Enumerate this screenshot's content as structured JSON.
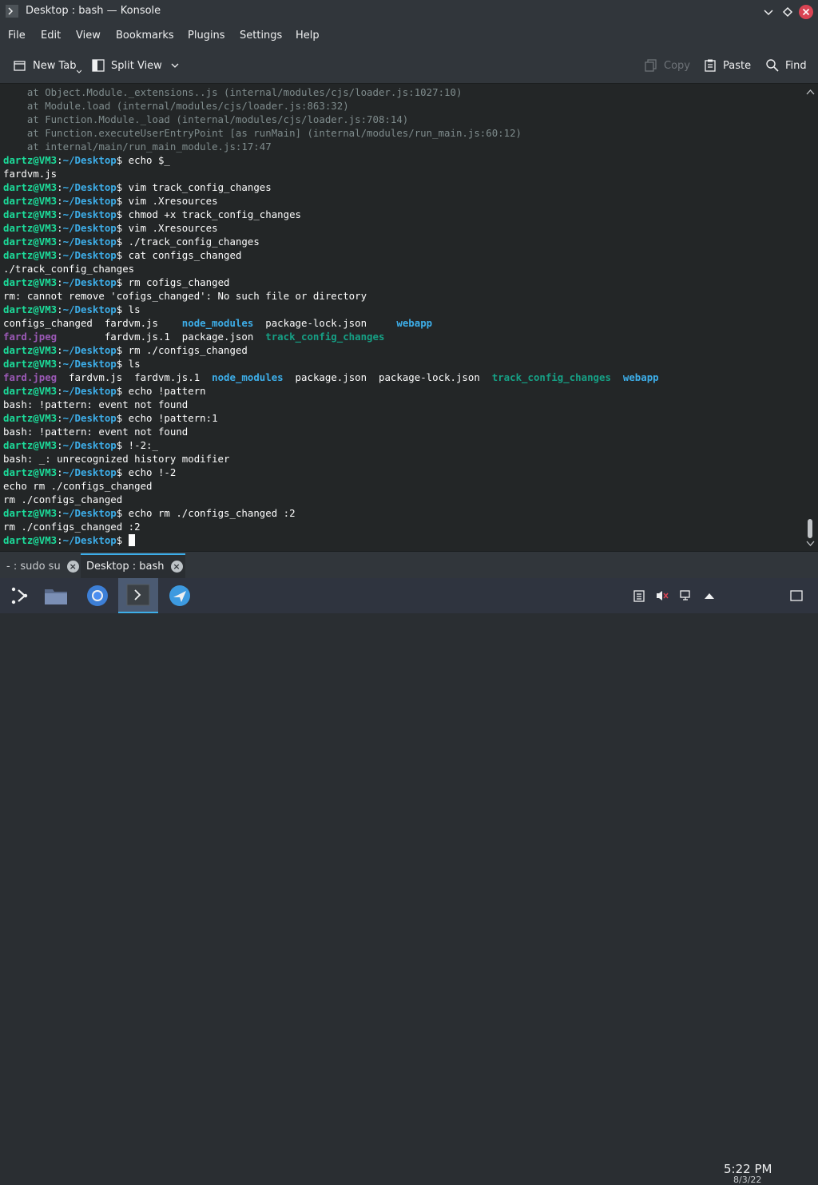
{
  "window": {
    "title": "Desktop : bash — Konsole"
  },
  "menu": [
    "File",
    "Edit",
    "View",
    "Bookmarks",
    "Plugins",
    "Settings",
    "Help"
  ],
  "toolbar": {
    "new_tab": "New Tab",
    "split_view": "Split View",
    "copy": "Copy",
    "paste": "Paste",
    "find": "Find"
  },
  "terminal": {
    "prompt_user": "dartz@VM3",
    "prompt_path": "~/Desktop",
    "lines": [
      {
        "segs": [
          {
            "t": "    at Object.Module._extensions..js (internal/modules/cjs/loader.js:1027:10)",
            "c": "dim"
          }
        ]
      },
      {
        "segs": [
          {
            "t": "    at Module.load (internal/modules/cjs/loader.js:863:32)",
            "c": "dim"
          }
        ]
      },
      {
        "segs": [
          {
            "t": "    at Function.Module._load (internal/modules/cjs/loader.js:708:14)",
            "c": "dim"
          }
        ]
      },
      {
        "segs": [
          {
            "t": "    at Function.executeUserEntryPoint [as runMain] (internal/modules/run_main.js:60:12)",
            "c": "dim"
          }
        ]
      },
      {
        "segs": [
          {
            "t": "    at internal/main/run_main_module.js:17:47",
            "c": "dim"
          }
        ]
      },
      {
        "prompt": true,
        "cmd": "echo $_"
      },
      {
        "segs": [
          {
            "t": "fardvm.js"
          }
        ]
      },
      {
        "prompt": true,
        "cmd": "vim track_config_changes"
      },
      {
        "prompt": true,
        "cmd": "vim .Xresources"
      },
      {
        "prompt": true,
        "cmd": "chmod +x track_config_changes"
      },
      {
        "prompt": true,
        "cmd": "vim .Xresources"
      },
      {
        "prompt": true,
        "cmd": "./track_config_changes"
      },
      {
        "prompt": true,
        "cmd": "cat configs_changed"
      },
      {
        "segs": [
          {
            "t": "./track_config_changes"
          }
        ]
      },
      {
        "prompt": true,
        "cmd": "rm cofigs_changed"
      },
      {
        "segs": [
          {
            "t": "rm: cannot remove 'cofigs_changed': No such file or directory"
          }
        ]
      },
      {
        "prompt": true,
        "cmd": "ls"
      },
      {
        "segs": [
          {
            "t": "configs_changed  fardvm.js    "
          },
          {
            "t": "node_modules",
            "c": "blue"
          },
          {
            "t": "  package-lock.json     "
          },
          {
            "t": "webapp",
            "c": "blue"
          }
        ]
      },
      {
        "segs": [
          {
            "t": "fard.jpeg",
            "c": "purple"
          },
          {
            "t": "        fardvm.js.1  package.json  "
          },
          {
            "t": "track_config_changes",
            "c": "teal"
          }
        ]
      },
      {
        "prompt": true,
        "cmd": "rm ./configs_changed"
      },
      {
        "prompt": true,
        "cmd": "ls"
      },
      {
        "segs": [
          {
            "t": "fard.jpeg",
            "c": "purple"
          },
          {
            "t": "  fardvm.js  fardvm.js.1  "
          },
          {
            "t": "node_modules",
            "c": "blue"
          },
          {
            "t": "  package.json  package-lock.json  "
          },
          {
            "t": "track_config_changes",
            "c": "teal"
          },
          {
            "t": "  "
          },
          {
            "t": "webapp",
            "c": "blue"
          }
        ]
      },
      {
        "prompt": true,
        "cmd": "echo !pattern"
      },
      {
        "segs": [
          {
            "t": "bash: !pattern: event not found"
          }
        ]
      },
      {
        "prompt": true,
        "cmd": "echo !pattern:1"
      },
      {
        "segs": [
          {
            "t": "bash: !pattern: event not found"
          }
        ]
      },
      {
        "prompt": true,
        "cmd": "!-2:_"
      },
      {
        "segs": [
          {
            "t": "bash: _: unrecognized history modifier"
          }
        ]
      },
      {
        "prompt": true,
        "cmd": "echo !-2"
      },
      {
        "segs": [
          {
            "t": "echo rm ./configs_changed"
          }
        ]
      },
      {
        "segs": [
          {
            "t": "rm ./configs_changed"
          }
        ]
      },
      {
        "prompt": true,
        "cmd": "echo rm ./configs_changed :2"
      },
      {
        "segs": [
          {
            "t": "rm ./configs_changed :2"
          }
        ]
      },
      {
        "prompt": true,
        "cmd": "",
        "cursor": true
      }
    ]
  },
  "tabs": [
    {
      "label": "- : sudo su",
      "active": false
    },
    {
      "label": "Desktop : bash",
      "active": true
    }
  ],
  "taskbar": {
    "clock_time": "5:22 PM",
    "clock_date": "8/3/22"
  },
  "colors": {
    "prompt_user": "#1cdc9a",
    "prompt_path": "#3daee9",
    "directory": "#3daee9",
    "image": "#9b59b6",
    "executable": "#16a085",
    "accent": "#3daee9"
  }
}
